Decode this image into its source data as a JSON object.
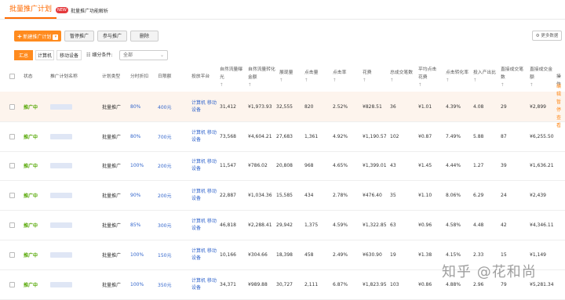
{
  "topbar": {
    "active_tab": "批量推广计划",
    "new_badge": "NEW",
    "link_tab": "批量推广功能解析"
  },
  "toolbar": {
    "new_plan": "新建推广计划",
    "pause": "暂停推广",
    "join": "参与推广",
    "delete": "删除",
    "more_data": "更多数据"
  },
  "segments": [
    "汇总",
    "计算机",
    "移动设备"
  ],
  "filter": {
    "label": "细分条件:",
    "value": "全部"
  },
  "columns": {
    "status": "状态",
    "name": "推广计划名称",
    "type": "计划类型",
    "timeshare": "分时折扣",
    "daily": "日限额",
    "platform": "投放平台",
    "natural_impr": "自然流量曝光",
    "natural_conv": "自然流量转化金额",
    "impressions": "展现量",
    "clicks": "点击量",
    "ctr": "点击率",
    "cost": "花费",
    "total_deals": "总成交笔数",
    "cpc": "平均点击花费",
    "conv_rate": "点击转化率",
    "roi": "投入产出比",
    "direct_deals": "直接成交笔数",
    "direct_amount": "直接成交金额",
    "ops": "操作",
    "sort": "↑"
  },
  "ops_labels": [
    "编辑",
    "暂停",
    "查看"
  ],
  "rows": [
    {
      "status": "推广中",
      "type": "批量推广",
      "timeshare": "80%",
      "daily": "400元",
      "platform": "计算机 移动设备",
      "natural_impr": "31,412",
      "natural_conv": "¥1,973.93",
      "impressions": "32,555",
      "clicks": "820",
      "ctr": "2.52%",
      "cost": "¥828.51",
      "total_deals": "36",
      "cpc": "¥1.01",
      "conv_rate": "4.39%",
      "roi": "4.08",
      "direct_deals": "29",
      "direct_amount": "¥2,899"
    },
    {
      "status": "推广中",
      "type": "批量推广",
      "timeshare": "80%",
      "daily": "700元",
      "platform": "计算机 移动设备",
      "natural_impr": "73,568",
      "natural_conv": "¥4,604.21",
      "impressions": "27,683",
      "clicks": "1,361",
      "ctr": "4.92%",
      "cost": "¥1,190.57",
      "total_deals": "102",
      "cpc": "¥0.87",
      "conv_rate": "7.49%",
      "roi": "5.88",
      "direct_deals": "87",
      "direct_amount": "¥6,255.50"
    },
    {
      "status": "推广中",
      "type": "批量推广",
      "timeshare": "100%",
      "daily": "200元",
      "platform": "计算机 移动设备",
      "natural_impr": "11,547",
      "natural_conv": "¥786.02",
      "impressions": "20,808",
      "clicks": "968",
      "ctr": "4.65%",
      "cost": "¥1,399.01",
      "total_deals": "43",
      "cpc": "¥1.45",
      "conv_rate": "4.44%",
      "roi": "1.27",
      "direct_deals": "39",
      "direct_amount": "¥1,636.21"
    },
    {
      "status": "推广中",
      "type": "批量推广",
      "timeshare": "90%",
      "daily": "200元",
      "platform": "计算机 移动设备",
      "natural_impr": "22,887",
      "natural_conv": "¥1,034.36",
      "impressions": "15,585",
      "clicks": "434",
      "ctr": "2.78%",
      "cost": "¥476.40",
      "total_deals": "35",
      "cpc": "¥1.10",
      "conv_rate": "8.06%",
      "roi": "6.29",
      "direct_deals": "24",
      "direct_amount": "¥2,439"
    },
    {
      "status": "推广中",
      "type": "批量推广",
      "timeshare": "85%",
      "daily": "300元",
      "platform": "计算机 移动设备",
      "natural_impr": "46,818",
      "natural_conv": "¥2,288.41",
      "impressions": "29,942",
      "clicks": "1,375",
      "ctr": "4.59%",
      "cost": "¥1,322.85",
      "total_deals": "63",
      "cpc": "¥0.96",
      "conv_rate": "4.58%",
      "roi": "4.48",
      "direct_deals": "42",
      "direct_amount": "¥4,346.11"
    },
    {
      "status": "推广中",
      "type": "批量推广",
      "timeshare": "100%",
      "daily": "150元",
      "platform": "计算机 移动设备",
      "natural_impr": "10,166",
      "natural_conv": "¥304.66",
      "impressions": "18,398",
      "clicks": "458",
      "ctr": "2.49%",
      "cost": "¥630.90",
      "total_deals": "19",
      "cpc": "¥1.38",
      "conv_rate": "4.15%",
      "roi": "2.33",
      "direct_deals": "15",
      "direct_amount": "¥1,149"
    },
    {
      "status": "推广中",
      "type": "批量推广",
      "timeshare": "100%",
      "daily": "350元",
      "platform": "计算机 移动设备",
      "natural_impr": "34,371",
      "natural_conv": "¥989.88",
      "impressions": "30,727",
      "clicks": "2,111",
      "ctr": "6.87%",
      "cost": "¥1,823.95",
      "total_deals": "103",
      "cpc": "¥0.86",
      "conv_rate": "4.88%",
      "roi": "2.96",
      "direct_deals": "79",
      "direct_amount": "¥5,281.34"
    }
  ],
  "watermark": "知乎 @花和尚",
  "colors": {
    "accent": "#ff8b1e",
    "active_status": "#52a600",
    "link": "#3366cc",
    "highlight_row": "#fdf4ed"
  }
}
